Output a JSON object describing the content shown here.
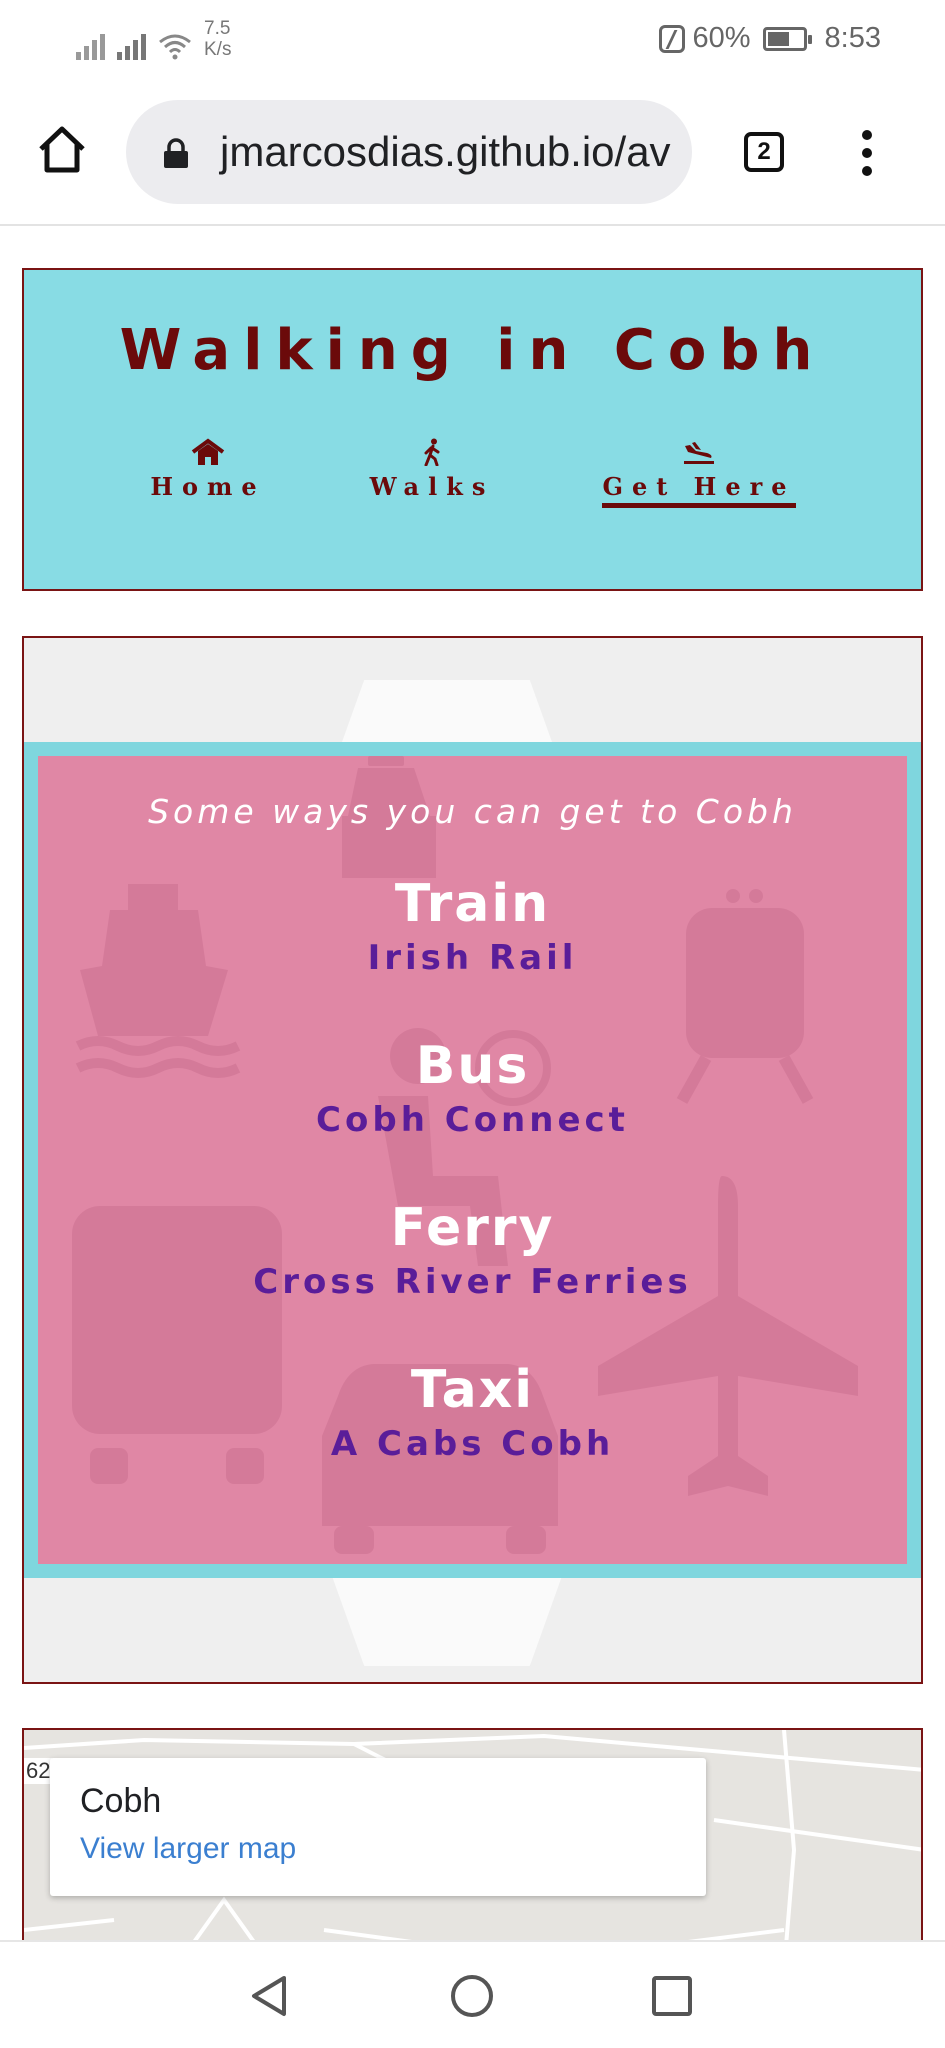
{
  "status_bar": {
    "net_speed_value": "7.5",
    "net_speed_unit": "K/s",
    "battery": "60%",
    "time": "8:53"
  },
  "browser": {
    "url": "jmarcosdias.github.io/av",
    "tab_count": "2"
  },
  "site": {
    "title": "Walking in Cobh",
    "nav": [
      {
        "label": "Home",
        "icon": "home-icon",
        "active": false
      },
      {
        "label": "Walks",
        "icon": "walking-person-icon",
        "active": false
      },
      {
        "label": "Get Here",
        "icon": "plane-landing-icon",
        "active": true
      }
    ]
  },
  "ways": {
    "title": "Some ways you can get to Cobh",
    "modes": [
      {
        "name": "Train",
        "provider": "Irish Rail"
      },
      {
        "name": "Bus",
        "provider": "Cobh Connect"
      },
      {
        "name": "Ferry",
        "provider": "Cross River Ferries"
      },
      {
        "name": "Taxi",
        "provider": "A Cabs Cobh"
      }
    ]
  },
  "map": {
    "place": "Cobh",
    "link": "View larger map",
    "edge_label": "62"
  },
  "colors": {
    "header_bg": "#88dce4",
    "brand_dark_red": "#6b0a0a",
    "card_pink": "#e087a5",
    "provider_purple": "#5a1d99",
    "map_link_blue": "#3b7fd0"
  }
}
